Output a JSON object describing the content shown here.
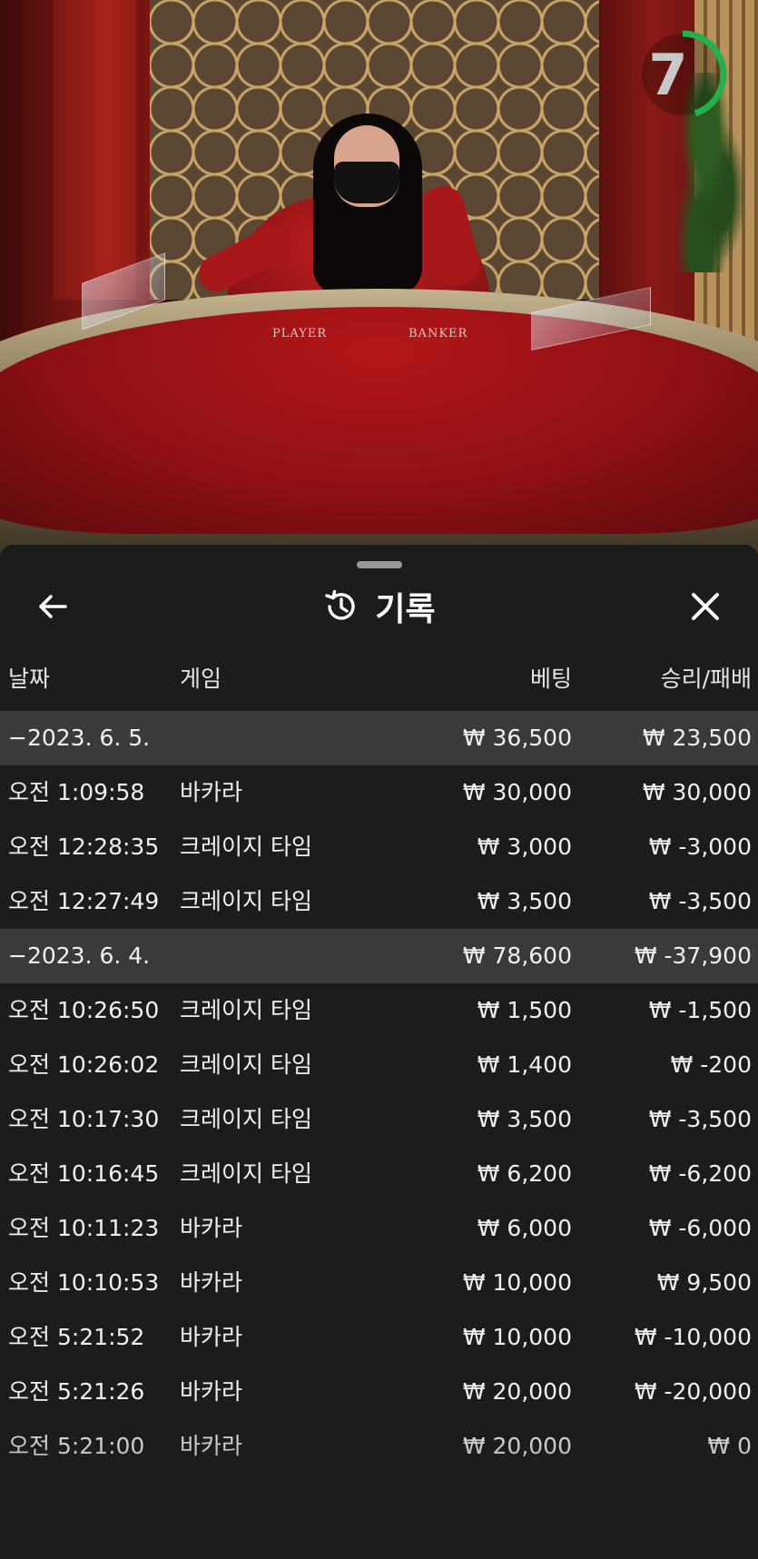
{
  "timer": {
    "value": "7",
    "progress": 0.45,
    "color": "#22b14c"
  },
  "table_felt": {
    "player": "PLAYER",
    "banker": "BANKER"
  },
  "history": {
    "title": "기록",
    "title_icon": "history-icon",
    "back_icon": "arrow-left-icon",
    "close_icon": "close-icon",
    "columns": {
      "date": "날짜",
      "game": "게임",
      "bet": "베팅",
      "result": "승리/패배"
    },
    "rows": [
      {
        "type": "group",
        "date": "−2023. 6. 5.",
        "game": "",
        "bet": "₩ 36,500",
        "result": "₩ 23,500"
      },
      {
        "type": "item",
        "date": "오전 1:09:58",
        "game": "바카라",
        "bet": "₩ 30,000",
        "result": "₩ 30,000"
      },
      {
        "type": "item",
        "date": "오전 12:28:35",
        "game": "크레이지 타임",
        "bet": "₩ 3,000",
        "result": "₩ -3,000"
      },
      {
        "type": "item",
        "date": "오전 12:27:49",
        "game": "크레이지 타임",
        "bet": "₩ 3,500",
        "result": "₩ -3,500"
      },
      {
        "type": "group",
        "date": "−2023. 6. 4.",
        "game": "",
        "bet": "₩ 78,600",
        "result": "₩ -37,900"
      },
      {
        "type": "item",
        "date": "오전 10:26:50",
        "game": "크레이지 타임",
        "bet": "₩ 1,500",
        "result": "₩ -1,500"
      },
      {
        "type": "item",
        "date": "오전 10:26:02",
        "game": "크레이지 타임",
        "bet": "₩ 1,400",
        "result": "₩ -200"
      },
      {
        "type": "item",
        "date": "오전 10:17:30",
        "game": "크레이지 타임",
        "bet": "₩ 3,500",
        "result": "₩ -3,500"
      },
      {
        "type": "item",
        "date": "오전 10:16:45",
        "game": "크레이지 타임",
        "bet": "₩ 6,200",
        "result": "₩ -6,200"
      },
      {
        "type": "item",
        "date": "오전 10:11:23",
        "game": "바카라",
        "bet": "₩ 6,000",
        "result": "₩ -6,000"
      },
      {
        "type": "item",
        "date": "오전 10:10:53",
        "game": "바카라",
        "bet": "₩ 10,000",
        "result": "₩ 9,500"
      },
      {
        "type": "item",
        "date": "오전 5:21:52",
        "game": "바카라",
        "bet": "₩ 10,000",
        "result": "₩ -10,000"
      },
      {
        "type": "item",
        "date": "오전 5:21:26",
        "game": "바카라",
        "bet": "₩ 20,000",
        "result": "₩ -20,000"
      },
      {
        "type": "item",
        "date": "오전 5:21:00",
        "game": "바카라",
        "bet": "₩ 20,000",
        "result": "₩ 0"
      }
    ]
  }
}
